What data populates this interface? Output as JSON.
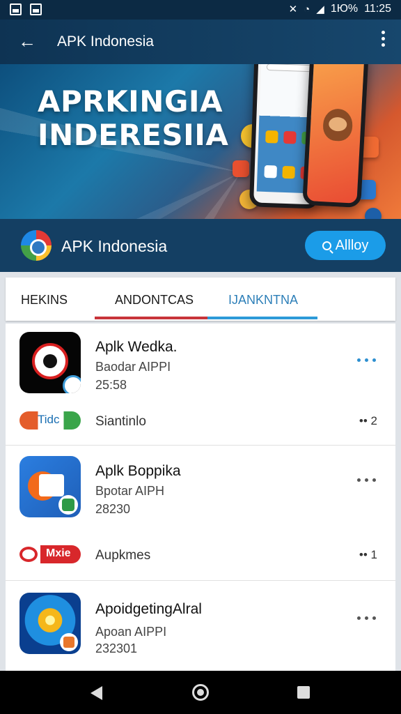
{
  "status_bar": {
    "network": "1Ю%",
    "time": "11:25"
  },
  "app_bar": {
    "title": "APK Indonesia"
  },
  "banner": {
    "line1": "APRKINGIA",
    "line2": "INDERESIIA"
  },
  "store_header": {
    "name": "APK Indonesia",
    "search_button": "Allloy"
  },
  "tabs": [
    {
      "label": "HEKINS"
    },
    {
      "label": "ANDONTCAS"
    },
    {
      "label": "IJANKNTNA"
    }
  ],
  "apps": [
    {
      "title": "Aplk Wedka.",
      "publisher": "Baodar AIPPI",
      "size": "25:58",
      "sub_label": "Siantinlo",
      "sub_glyph_text": "Tidc",
      "sub_count": "•• 2"
    },
    {
      "title": "Aplk Boppika",
      "publisher": "Bpotar AIPH",
      "size": "28230",
      "sub_label": "Aupkmes",
      "sub_glyph_text": "Mxie",
      "sub_count": "•• 1"
    },
    {
      "title": "ApoidgetingAlral",
      "publisher": "Apoan AIPPI",
      "size": "232301"
    }
  ],
  "colors": {
    "primary_dark": "#143f63",
    "accent_blue": "#1b9ce8",
    "tab_red": "#c8343a",
    "tab_blue": "#2d9ad8"
  }
}
